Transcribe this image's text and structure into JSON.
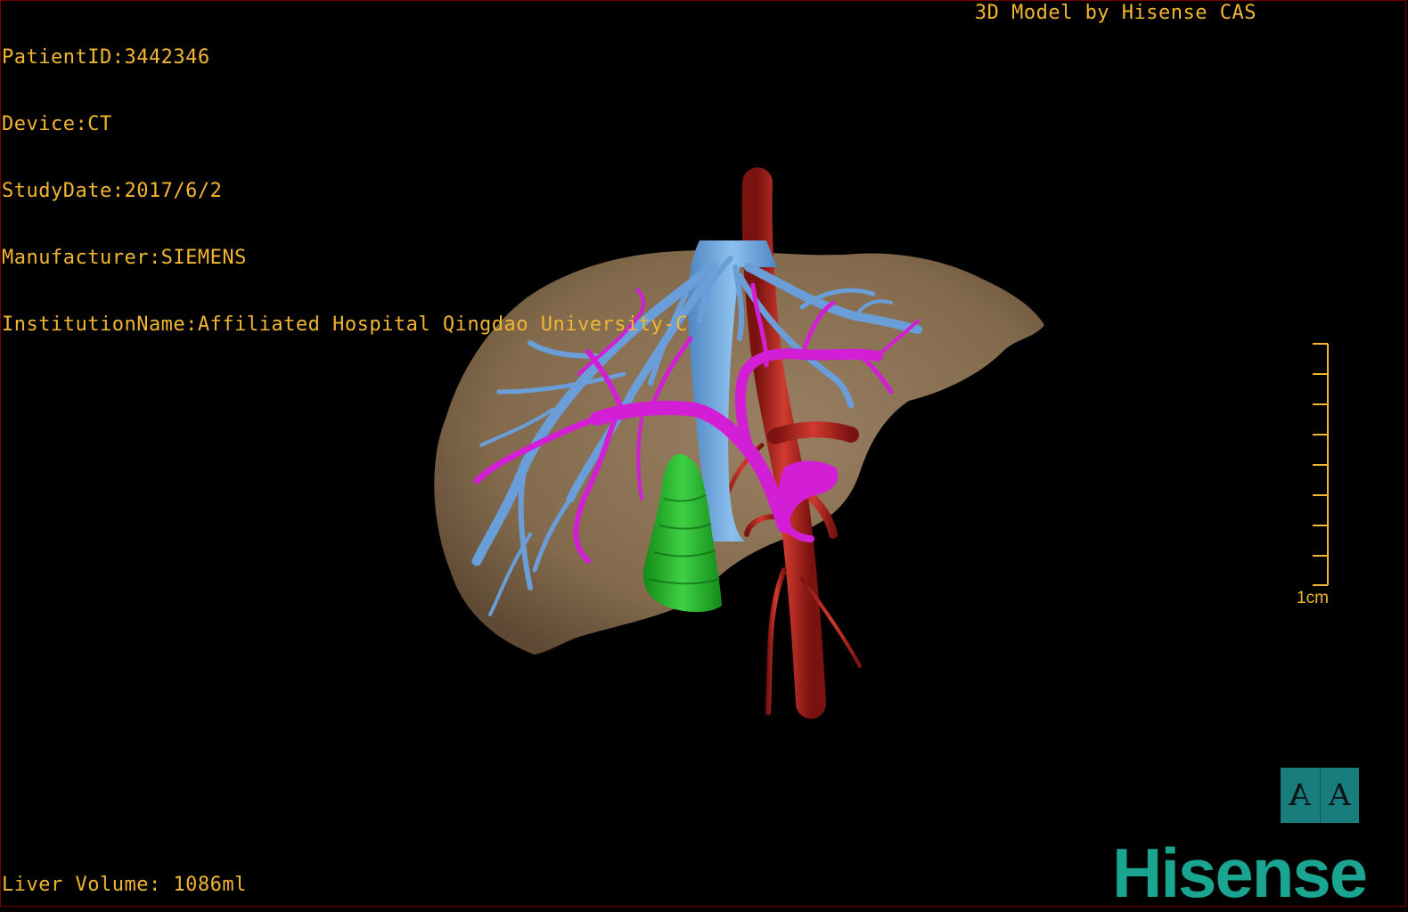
{
  "meta": {
    "patient_id": "PatientID:3442346",
    "device": "Device:CT",
    "study_date": "StudyDate:2017/6/2",
    "manufacturer": "Manufacturer:SIEMENS",
    "institution": "InstitutionName:Affiliated Hospital Qingdao University-C"
  },
  "model_caption": "3D Model by Hisense CAS",
  "liver_volume": "Liver Volume: 1086ml",
  "scale_bar": {
    "label": "1cm"
  },
  "view_toggle": {
    "left_glyph": "A",
    "right_glyph": "A"
  },
  "brand": {
    "name": "Hisense"
  },
  "colors": {
    "overlay_text": "#f2b632",
    "liver": "#8c7455",
    "hepatic_vein": "#6a9ed8",
    "portal_vein": "#d21fd6",
    "artery": "#b0201a",
    "gallbladder": "#1fb222",
    "brand": "#19a58f"
  }
}
